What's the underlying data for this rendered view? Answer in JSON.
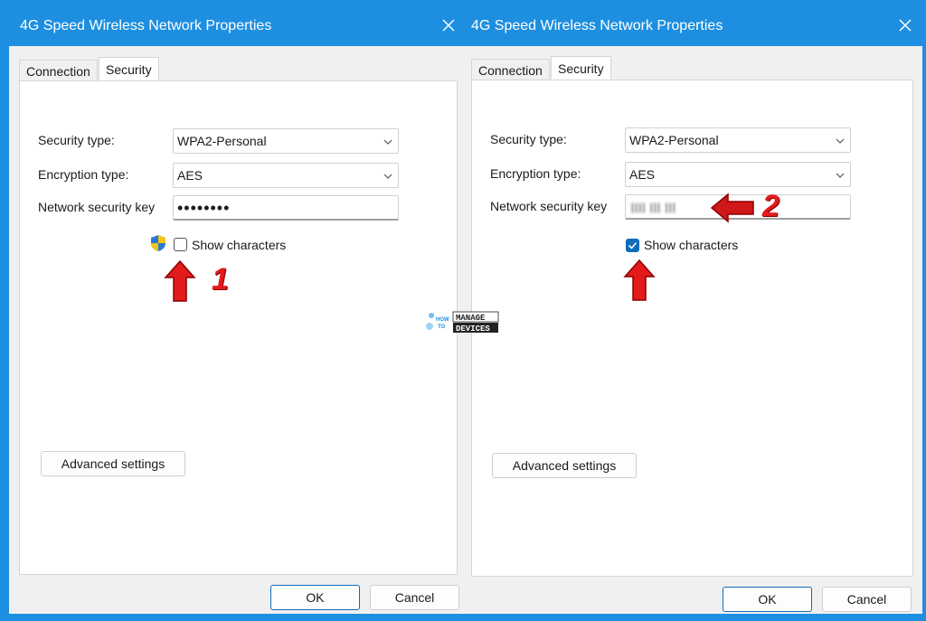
{
  "left_dialog": {
    "title": "4G Speed Wireless Network Properties",
    "tabs": [
      "Connection",
      "Security"
    ],
    "security_type_label": "Security type:",
    "security_type_value": "WPA2-Personal",
    "encryption_type_label": "Encryption type:",
    "encryption_type_value": "AES",
    "network_key_label": "Network security key",
    "network_key_value": "••••••••",
    "show_characters_label": "Show characters",
    "show_characters_checked": false,
    "advanced_button": "Advanced settings",
    "ok_button": "OK",
    "cancel_button": "Cancel",
    "annotation_number": "1"
  },
  "right_dialog": {
    "title": "4G Speed Wireless Network Properties",
    "tabs": [
      "Connection",
      "Security"
    ],
    "security_type_label": "Security type:",
    "security_type_value": "WPA2-Personal",
    "encryption_type_label": "Encryption type:",
    "encryption_type_value": "AES",
    "network_key_label": "Network security key",
    "network_key_value": "",
    "show_characters_label": "Show characters",
    "show_characters_checked": true,
    "advanced_button": "Advanced settings",
    "ok_button": "OK",
    "cancel_button": "Cancel",
    "annotation_number": "2"
  },
  "watermark": {
    "line1": "HOW",
    "line2": "TO",
    "word1": "MANAGE",
    "word2": "DEVICES"
  },
  "colors": {
    "title_bar": "#1e8fe0",
    "annotation_red": "#e31b1b",
    "checkbox_checked": "#0f6cbd"
  }
}
